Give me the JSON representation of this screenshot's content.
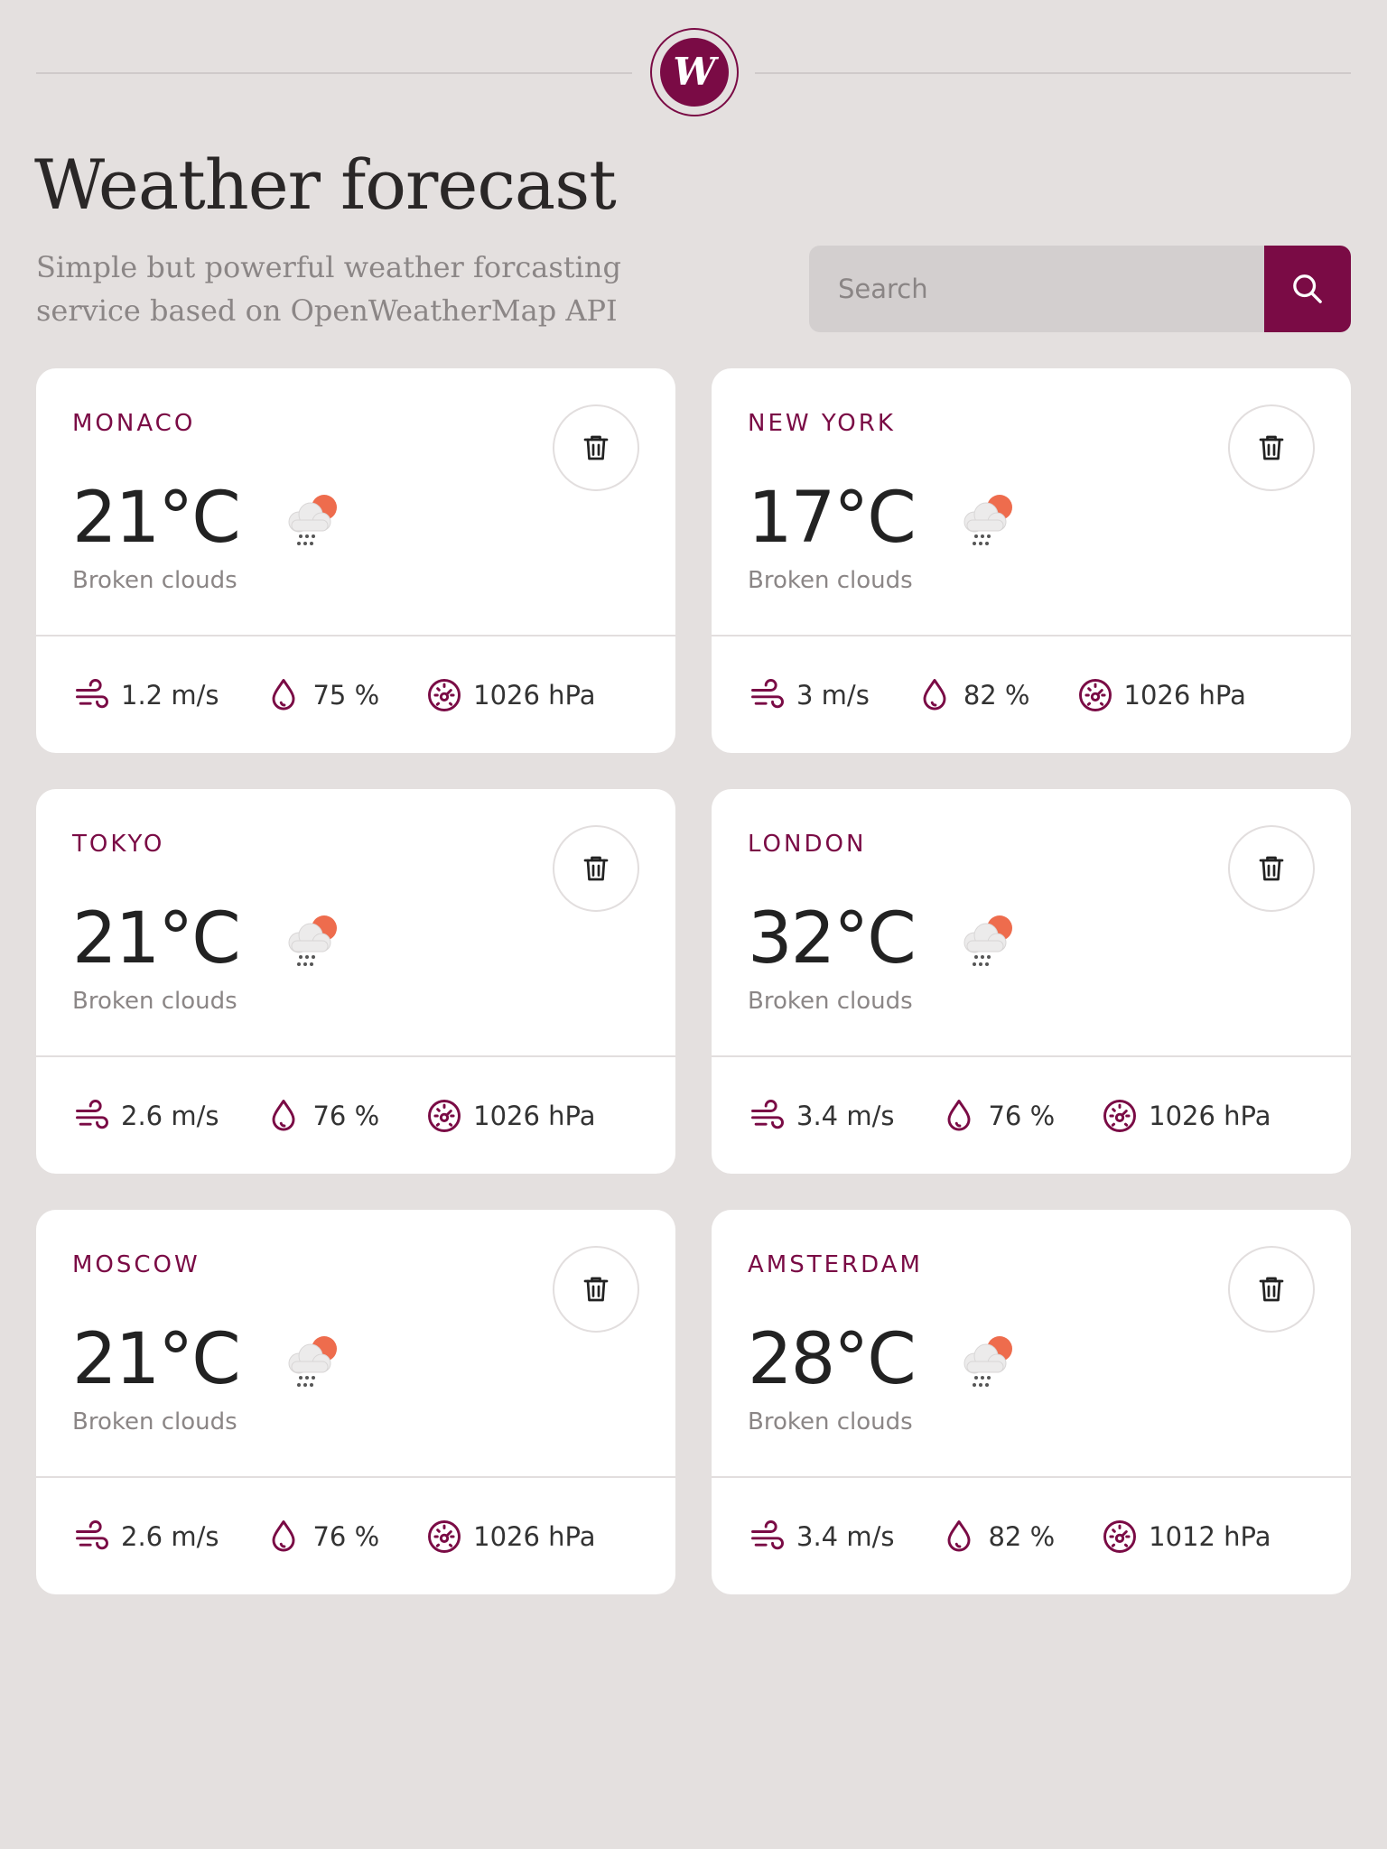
{
  "header": {
    "logo_letter": "W",
    "title": "Weather forecast",
    "subtitle_line1": "Simple but powerful weather forcasting",
    "subtitle_line2": "service based on OpenWeatherMap API"
  },
  "search": {
    "placeholder": "Search",
    "value": ""
  },
  "colors": {
    "accent": "#7a0b45",
    "background": "#e4e0df",
    "card": "#ffffff",
    "sun": "#ee6c4d"
  },
  "icons": {
    "search": "search-icon",
    "delete": "trash-icon",
    "weather": "cloud-rain-sun-icon",
    "wind": "wind-icon",
    "humidity": "droplet-icon",
    "pressure": "gauge-icon"
  },
  "cards": [
    {
      "city": "MONACO",
      "temp": "21°C",
      "description": "Broken clouds",
      "wind": "1.2 m/s",
      "humidity": "75 %",
      "pressure": "1026 hPa"
    },
    {
      "city": "NEW YORK",
      "temp": "17°C",
      "description": "Broken clouds",
      "wind": "3 m/s",
      "humidity": "82 %",
      "pressure": "1026 hPa"
    },
    {
      "city": "TOKYO",
      "temp": "21°C",
      "description": "Broken clouds",
      "wind": "2.6 m/s",
      "humidity": "76 %",
      "pressure": "1026 hPa"
    },
    {
      "city": "LONDON",
      "temp": "32°C",
      "description": "Broken clouds",
      "wind": "3.4 m/s",
      "humidity": "76 %",
      "pressure": "1026 hPa"
    },
    {
      "city": "MOSCOW",
      "temp": "21°C",
      "description": "Broken clouds",
      "wind": "2.6 m/s",
      "humidity": "76 %",
      "pressure": "1026 hPa"
    },
    {
      "city": "AMSTERDAM",
      "temp": "28°C",
      "description": "Broken clouds",
      "wind": "3.4 m/s",
      "humidity": "82 %",
      "pressure": "1012 hPa"
    }
  ]
}
